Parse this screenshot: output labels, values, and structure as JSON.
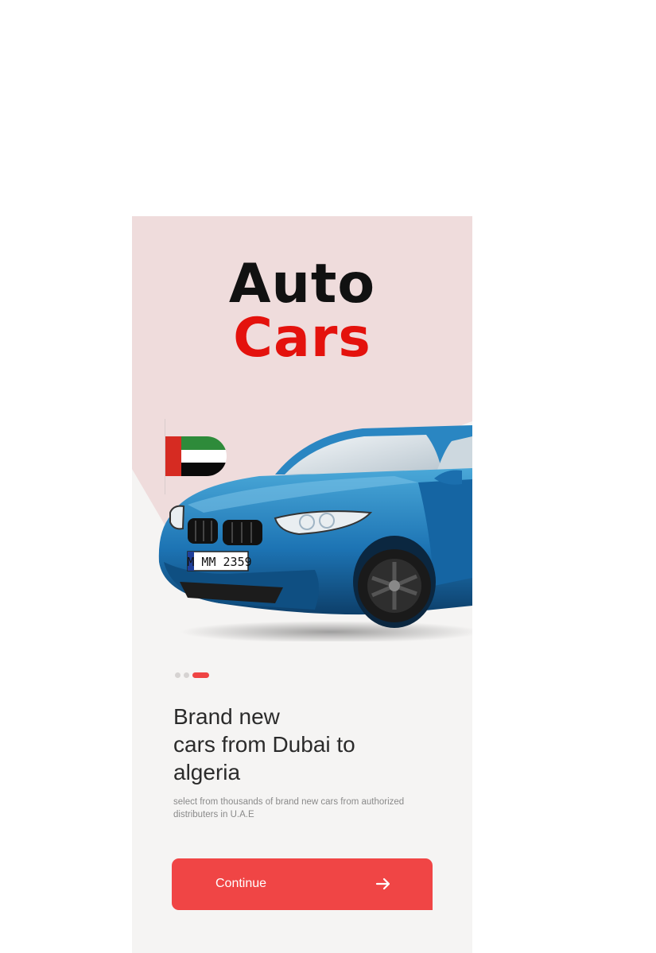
{
  "logo": {
    "line1": "Auto",
    "line2": "Cars"
  },
  "pager": {
    "total": 3,
    "active_index": 2
  },
  "hero": {
    "flag_icon": "uae-flag-icon",
    "image": "blue-car-image",
    "plate": "M MM 2359"
  },
  "onboarding": {
    "headline": "Brand new\ncars from Dubai to\nalgeria",
    "subtext": "select from thousands of brand new cars from authorized distributers in U.A.E"
  },
  "continue_button": {
    "label": "Continue",
    "icon": "arrow-right-icon"
  },
  "colors": {
    "hero_background": "#efdcdc",
    "screen_background": "#f5f4f3",
    "accent": "#f04545",
    "logo_red": "#e4120d",
    "logo_black": "#111111"
  }
}
